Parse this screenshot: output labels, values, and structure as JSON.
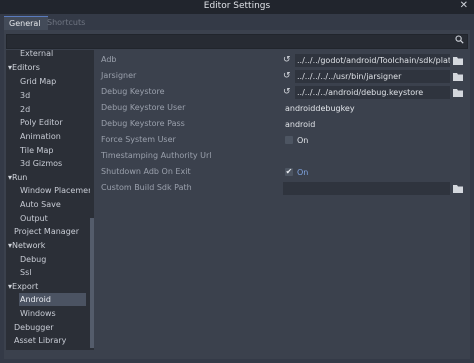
{
  "window": {
    "title": "Editor Settings",
    "close_glyph": "✕"
  },
  "tabs": [
    {
      "label": "General"
    },
    {
      "label": "Shortcuts"
    }
  ],
  "search": {
    "placeholder": "",
    "value": "",
    "icon": "search-icon"
  },
  "tree": {
    "items": [
      {
        "label": "External"
      },
      {
        "label": "▾Editors"
      },
      {
        "label": "Grid Map"
      },
      {
        "label": "3d"
      },
      {
        "label": "2d"
      },
      {
        "label": "Poly Editor"
      },
      {
        "label": "Animation"
      },
      {
        "label": "Tile Map"
      },
      {
        "label": "3d Gizmos"
      },
      {
        "label": "▾Run"
      },
      {
        "label": "Window Placemen"
      },
      {
        "label": "Auto Save"
      },
      {
        "label": "Output"
      },
      {
        "label": "Project Manager"
      },
      {
        "label": "▾Network"
      },
      {
        "label": "Debug"
      },
      {
        "label": "Ssl"
      },
      {
        "label": "▾Export"
      },
      {
        "label": "Android"
      },
      {
        "label": "Windows"
      },
      {
        "label": "Debugger"
      },
      {
        "label": "Asset Library"
      }
    ],
    "selected": "Android"
  },
  "properties": [
    {
      "label": "Adb",
      "value": "../../../godot/android/Toolchain/sdk/platform-t"
    },
    {
      "label": "Jarsigner",
      "value": "../../../../../usr/bin/jarsigner"
    },
    {
      "label": "Debug Keystore",
      "value": "../../../../android/debug.keystore"
    },
    {
      "label": "Debug Keystore User",
      "value": "androiddebugkey"
    },
    {
      "label": "Debug Keystore Pass",
      "value": "android"
    },
    {
      "label": "Force System User",
      "value": "On",
      "checked": false
    },
    {
      "label": "Timestamping Authority Url",
      "value": ""
    },
    {
      "label": "Shutdown Adb On Exit",
      "value": "On",
      "checked": true
    },
    {
      "label": "Custom Build Sdk Path",
      "value": ""
    }
  ],
  "colors": {
    "background": "#343a47",
    "titlebar": "#21252d",
    "tree_bg": "#2b2f37",
    "selection": "#4b5362",
    "accent": "#7fa3e0"
  }
}
